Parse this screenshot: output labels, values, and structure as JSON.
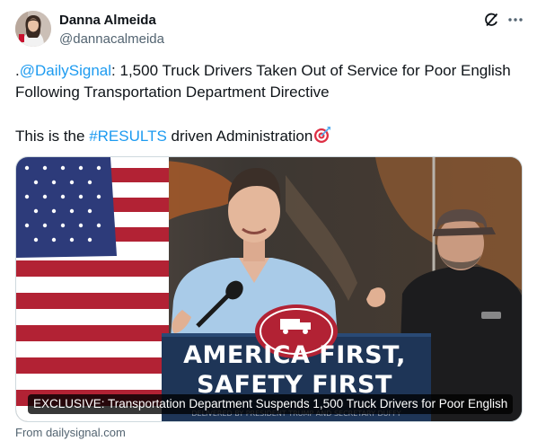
{
  "author": {
    "name": "Danna Almeida",
    "handle": "@dannacalmeida",
    "avatar_icon": "profile-photo-avatar"
  },
  "actions": {
    "grok_icon": "grok-slash-icon",
    "more_icon": "more-dots-icon"
  },
  "tweet": {
    "line1_prefix": ".",
    "line1_mention": "@DailySignal",
    "line1_rest": ": 1,500 Truck Drivers Taken Out of Service for Poor English",
    "line2": "Following Transportation Department Directive",
    "line3_prefix": "This is the ",
    "line3_hashtag": "#RESULTS",
    "line3_rest": " driven Administration",
    "line3_emoji": "direct-hit-target-emoji"
  },
  "card": {
    "podium_line1": "AMERICA FIRST,",
    "podium_line2": "SAFETY FIRST",
    "caption": "EXCLUSIVE: Transportation Department Suspends 1,500 Truck Drivers for Poor English",
    "source": "From dailysignal.com"
  },
  "colors": {
    "link": "#1d9bf0",
    "secondary_text": "#536471",
    "podium_navy": "#1e3557",
    "flag_red": "#b22234"
  }
}
